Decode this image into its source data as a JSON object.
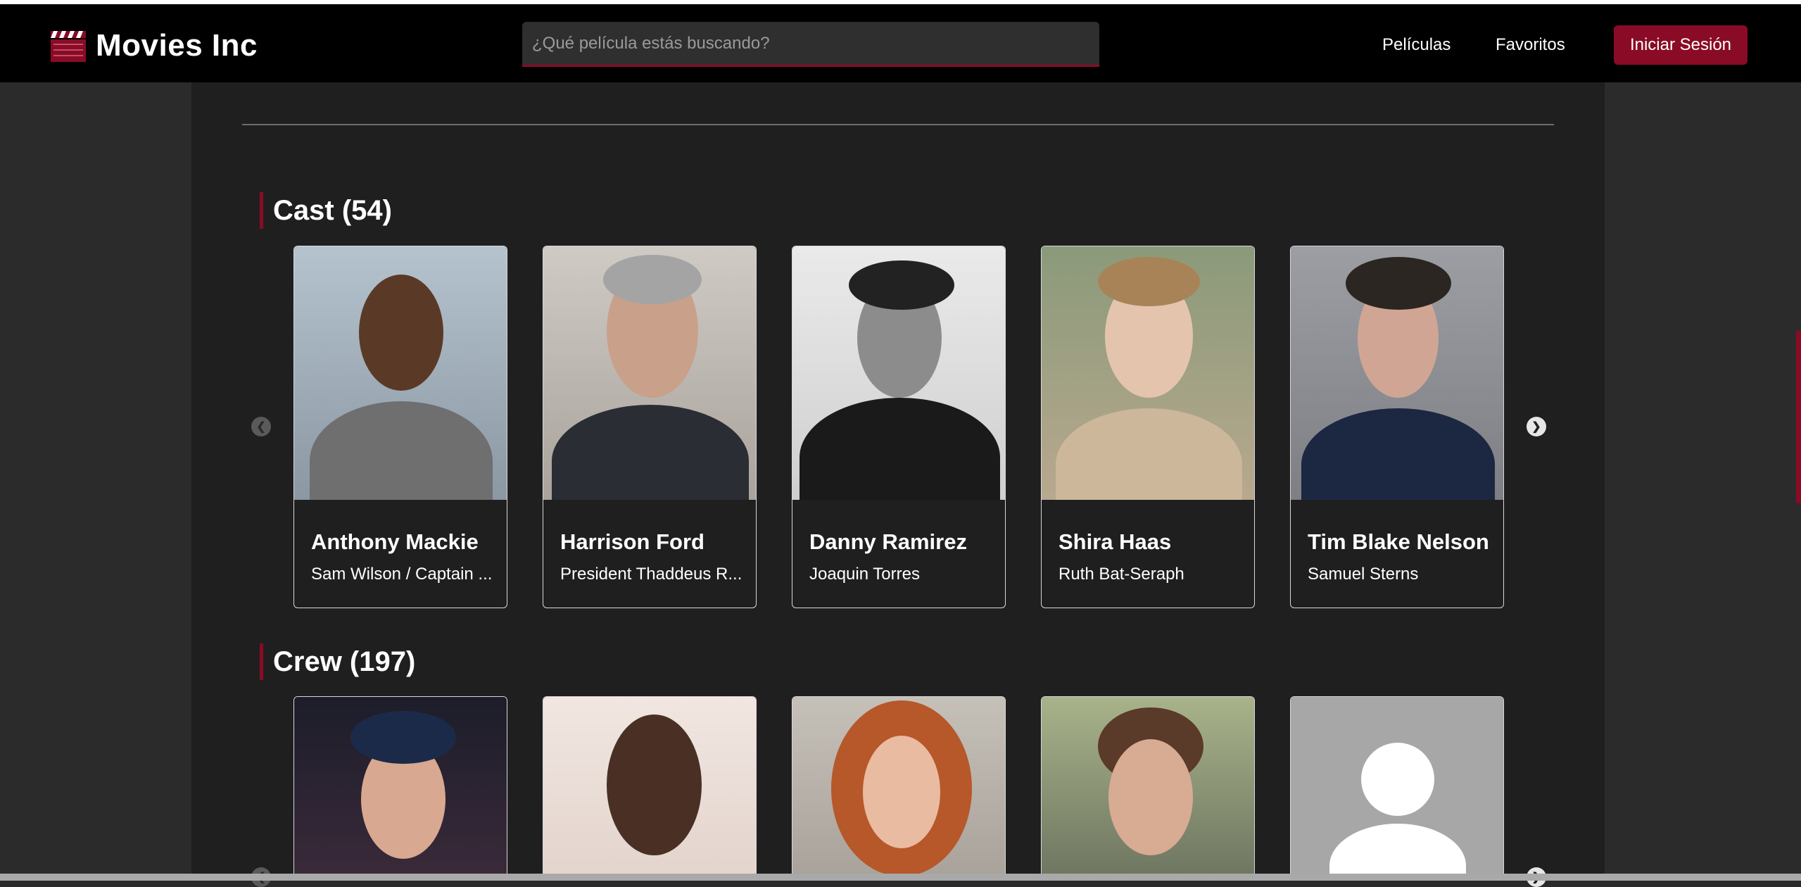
{
  "app": {
    "title": "Movies Inc"
  },
  "search": {
    "placeholder": "¿Qué película estás buscando?"
  },
  "nav": {
    "movies": "Películas",
    "favorites": "Favoritos",
    "login": "Iniciar Sesión"
  },
  "cast": {
    "title": "Cast (54)",
    "people": [
      {
        "name": "Anthony Mackie",
        "role": "Sam Wilson / Captain ..."
      },
      {
        "name": "Harrison Ford",
        "role": "President Thaddeus R..."
      },
      {
        "name": "Danny Ramirez",
        "role": "Joaquin Torres"
      },
      {
        "name": "Shira Haas",
        "role": "Ruth Bat-Seraph"
      },
      {
        "name": "Tim Blake Nelson",
        "role": "Samuel Sterns"
      }
    ]
  },
  "crew": {
    "title": "Crew (197)"
  },
  "icons": {
    "logo": "clapperboard-icon",
    "prev": "chevron-left-icon",
    "next": "chevron-right-icon",
    "placeholder": "person-placeholder-icon"
  },
  "colors": {
    "accent": "#8a0b26",
    "navbar": "#000000",
    "content_bg": "#1f1f1f",
    "page_bg": "#2b2b2b"
  }
}
